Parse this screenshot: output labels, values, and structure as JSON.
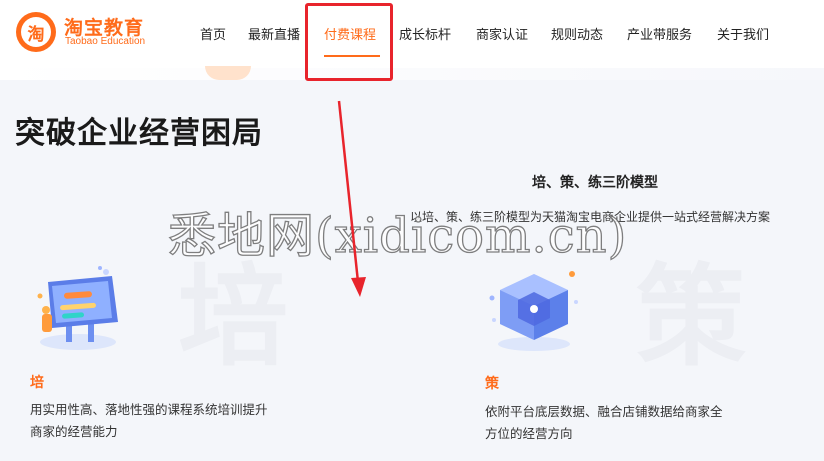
{
  "brand": {
    "logo_char": "淘",
    "name": "淘宝教育",
    "subtitle": "Taobao Education"
  },
  "nav": {
    "items": [
      {
        "label": "首页"
      },
      {
        "label": "最新直播"
      },
      {
        "label": "付费课程"
      },
      {
        "label": "成长标杆"
      },
      {
        "label": "商家认证"
      },
      {
        "label": "规则动态"
      },
      {
        "label": "产业带服务"
      },
      {
        "label": "关于我们"
      }
    ],
    "active_index": 2
  },
  "page": {
    "title": "突破企业经营困局"
  },
  "section": {
    "title": "培、策、练三阶模型",
    "subtitle": "以培、策、练三阶模型为天猫淘宝电商企业提供一站式经营解决方案"
  },
  "cards": [
    {
      "bg_char": "培",
      "title": "培",
      "desc_line1": "用实用性高、落地性强的课程系统培训提升",
      "desc_line2": "商家的经营能力"
    },
    {
      "bg_char": "策",
      "title": "策",
      "desc_line1": "依附平台底层数据、融合店铺数据给商家全",
      "desc_line2": "方位的经营方向"
    }
  ],
  "watermark": {
    "text": "悉地网(xidicom.cn)"
  },
  "colors": {
    "accent": "#ff6b1a",
    "annotation": "#e8242c",
    "text": "#222222",
    "background": "#f4f6fa"
  }
}
